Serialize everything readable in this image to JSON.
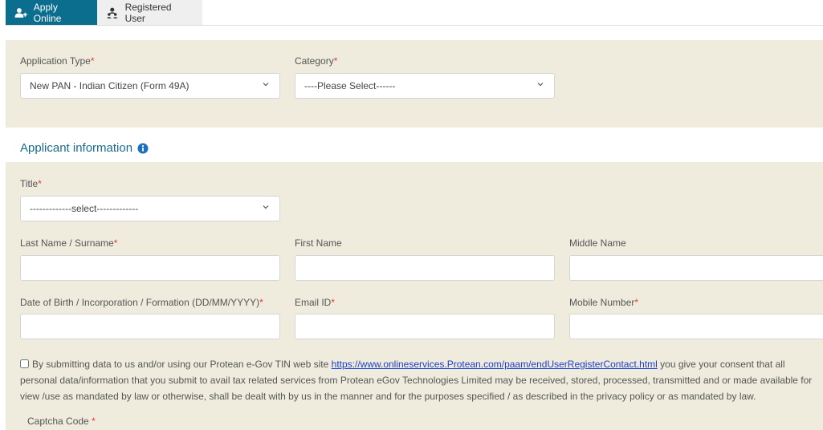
{
  "tabs": [
    {
      "label": "Apply Online",
      "icon": "user-plus-icon",
      "active": true
    },
    {
      "label": "Registered User",
      "icon": "user-group-icon",
      "active": false
    }
  ],
  "form": {
    "application_type": {
      "label": "Application Type",
      "required": "*",
      "value": "New PAN - Indian Citizen (Form 49A)"
    },
    "category": {
      "label": "Category",
      "required": "*",
      "value": "----Please Select------"
    },
    "section_title": "Applicant information",
    "title": {
      "label": "Title",
      "required": "*",
      "value": "-------------select-------------"
    },
    "last_name": {
      "label": "Last Name / Surname",
      "required": "*",
      "value": ""
    },
    "first_name": {
      "label": "First Name",
      "value": ""
    },
    "middle_name": {
      "label": "Middle Name",
      "value": ""
    },
    "dob": {
      "label": "Date of Birth / Incorporation / Formation (DD/MM/YYYY)",
      "required": "*",
      "value": ""
    },
    "email": {
      "label": "Email ID",
      "required": "*",
      "value": ""
    },
    "mobile": {
      "label": "Mobile Number",
      "required": "*",
      "value": ""
    },
    "consent": {
      "text_before": "By submitting data to us and/or using our Protean e-Gov TIN web site ",
      "link": "https://www.onlineservices.Protean.com/paam/endUserRegisterContact.html",
      "text_after": " you give your consent that all personal data/information that you submit to avail tax related services from Protean eGov Technologies Limited may be received, stored, processed, transmitted and or made available for view /use as mandated by law or otherwise, shall be dealt with by us in the manner and for the purposes specified / as described in the privacy policy or as mandated by law."
    },
    "captcha": {
      "label": "Captcha Code",
      "required": "*"
    }
  },
  "colors": {
    "accent": "#0b6e8f",
    "panel": "#efecde",
    "required": "#e23b3b",
    "link": "#1a3fcf",
    "heading": "#1a6b8a"
  }
}
